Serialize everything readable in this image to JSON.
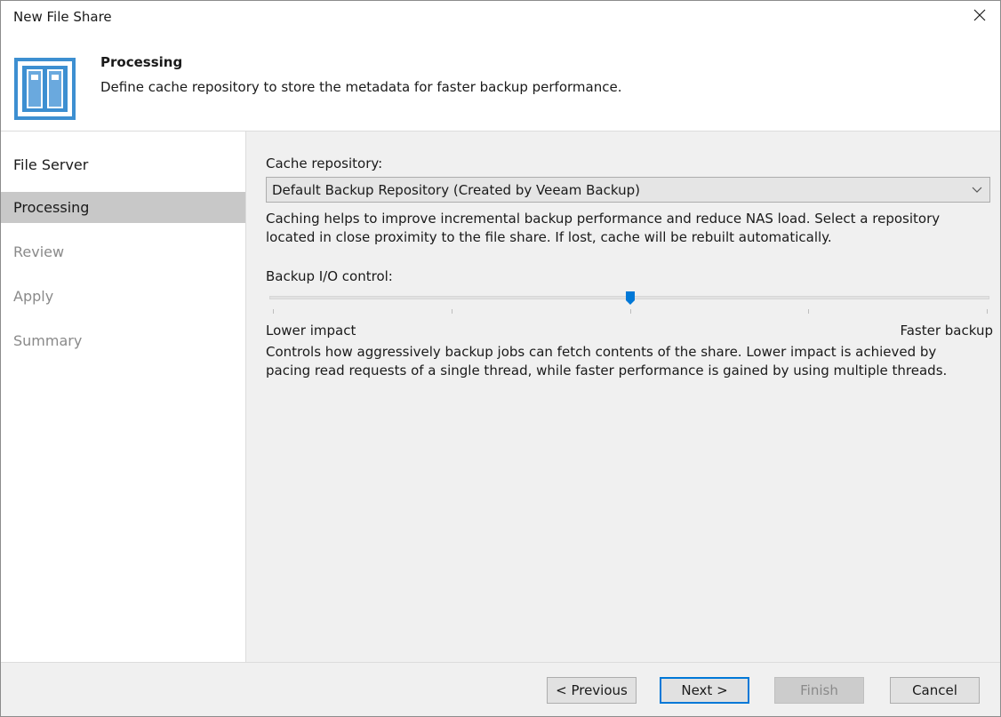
{
  "window": {
    "title": "New File Share"
  },
  "header": {
    "title": "Processing",
    "description": "Define cache repository to store the metadata for faster backup performance."
  },
  "sidebar": {
    "items": [
      {
        "label": "File Server",
        "state": "enabled"
      },
      {
        "label": "Processing",
        "state": "active"
      },
      {
        "label": "Review",
        "state": "disabled"
      },
      {
        "label": "Apply",
        "state": "disabled"
      },
      {
        "label": "Summary",
        "state": "disabled"
      }
    ]
  },
  "main": {
    "cache_label": "Cache repository:",
    "cache_selected": "Default Backup Repository (Created by Veeam Backup)",
    "cache_help_line1": "Caching helps to improve incremental backup performance and reduce NAS load. Select a repository",
    "cache_help_line2": "located in close proximity to the file share. If lost, cache will be rebuilt automatically.",
    "io_label": "Backup I/O control:",
    "slider_value_fraction": 0.5,
    "slider_min_label": "Lower impact",
    "slider_max_label": "Faster backup",
    "io_help_line1": "Controls how aggressively backup jobs can fetch contents of the share. Lower impact is achieved by",
    "io_help_line2": "pacing read requests of a single thread, while faster performance is gained by using multiple threads."
  },
  "footer": {
    "previous": "< Previous",
    "next": "Next >",
    "finish": "Finish",
    "cancel": "Cancel"
  },
  "colors": {
    "accent": "#0078d7",
    "icon_blue": "#3d8fd1"
  },
  "icons": {
    "close": "close-icon",
    "header": "file-share-wizard-icon",
    "dropdown": "chevron-down-icon"
  }
}
